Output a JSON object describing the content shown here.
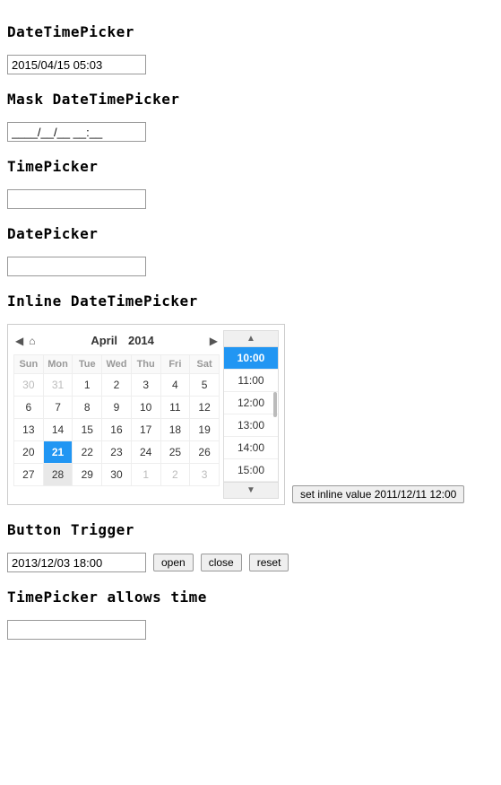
{
  "sections": {
    "datetimepicker": {
      "heading": "DateTimePicker",
      "value": "2015/04/15 05:03"
    },
    "mask": {
      "heading": "Mask DateTimePicker",
      "value": "____/__/__ __:__"
    },
    "timepicker": {
      "heading": "TimePicker",
      "value": ""
    },
    "datepicker": {
      "heading": "DatePicker",
      "value": ""
    },
    "inline": {
      "heading": "Inline DateTimePicker",
      "month": "April",
      "year": "2014",
      "weekdays": [
        "Sun",
        "Mon",
        "Tue",
        "Wed",
        "Thu",
        "Fri",
        "Sat"
      ],
      "weeks": [
        [
          {
            "d": "30",
            "o": true
          },
          {
            "d": "31",
            "o": true
          },
          {
            "d": "1"
          },
          {
            "d": "2"
          },
          {
            "d": "3"
          },
          {
            "d": "4"
          },
          {
            "d": "5"
          }
        ],
        [
          {
            "d": "6"
          },
          {
            "d": "7"
          },
          {
            "d": "8"
          },
          {
            "d": "9"
          },
          {
            "d": "10"
          },
          {
            "d": "11"
          },
          {
            "d": "12"
          }
        ],
        [
          {
            "d": "13"
          },
          {
            "d": "14"
          },
          {
            "d": "15"
          },
          {
            "d": "16"
          },
          {
            "d": "17"
          },
          {
            "d": "18"
          },
          {
            "d": "19"
          }
        ],
        [
          {
            "d": "20"
          },
          {
            "d": "21",
            "sel": true
          },
          {
            "d": "22"
          },
          {
            "d": "23"
          },
          {
            "d": "24"
          },
          {
            "d": "25"
          },
          {
            "d": "26"
          }
        ],
        [
          {
            "d": "27"
          },
          {
            "d": "28",
            "hl": true
          },
          {
            "d": "29"
          },
          {
            "d": "30"
          },
          {
            "d": "1",
            "o": true
          },
          {
            "d": "2",
            "o": true
          },
          {
            "d": "3",
            "o": true
          }
        ]
      ],
      "times": [
        {
          "t": "10:00",
          "sel": true
        },
        {
          "t": "11:00"
        },
        {
          "t": "12:00"
        },
        {
          "t": "13:00"
        },
        {
          "t": "14:00"
        },
        {
          "t": "15:00"
        }
      ],
      "set_button": "set inline value 2011/12/11 12:00"
    },
    "button_trigger": {
      "heading": "Button Trigger",
      "value": "2013/12/03 18:00",
      "open": "open",
      "close": "close",
      "reset": "reset"
    },
    "timepicker_allows": {
      "heading": "TimePicker allows time",
      "value": ""
    }
  }
}
